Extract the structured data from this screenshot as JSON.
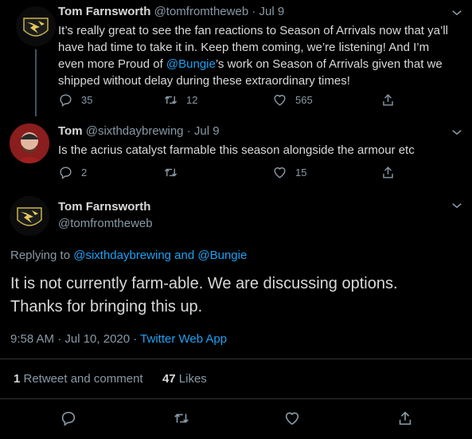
{
  "tweet1": {
    "name": "Tom Farnsworth",
    "handle": "@tomfromtheweb",
    "dot": "·",
    "date": "Jul 9",
    "text_a": "It’s really great to see the fan reactions to Season of Arrivals now that ya’ll have had time to take it in. Keep them coming, we’re listening! And I’m even more Proud of ",
    "mention": "@Bungie",
    "text_b": "’s work on Season of Arrivals given that we shipped without delay during these extraordinary times!",
    "replies": "35",
    "retweets": "12",
    "likes": "565"
  },
  "tweet2": {
    "name": "Tom",
    "handle": "@sixthdaybrewing",
    "dot": "·",
    "date": "Jul 9",
    "text": "Is the acrius catalyst farmable this season alongside the armour etc",
    "replies": "2",
    "retweets": "",
    "likes": "15"
  },
  "main": {
    "name": "Tom Farnsworth",
    "handle": "@tomfromtheweb",
    "replying_prefix": "Replying to ",
    "reply_user": "@sixthdaybrewing",
    "reply_and": " and ",
    "reply_user2": "@Bungie",
    "text_line1": "It is not currently farm-able. We are discussing options.",
    "text_line2": "Thanks for bringing this up.",
    "time": "9:58 AM · Jul 10, 2020",
    "dot": " · ",
    "source": "Twitter Web App",
    "retweet_count": "1",
    "retweet_label": " Retweet and comment",
    "like_count": "47",
    "like_label": " Likes"
  },
  "colors": {
    "background": "#000000",
    "text": "#d9d9d9",
    "muted": "#8899a6",
    "link": "#1da1f2",
    "thread_line": "#3d5466",
    "divider": "#2f3336"
  },
  "icons": [
    "reply-icon",
    "retweet-icon",
    "like-icon",
    "share-icon",
    "chevron-down-icon"
  ]
}
